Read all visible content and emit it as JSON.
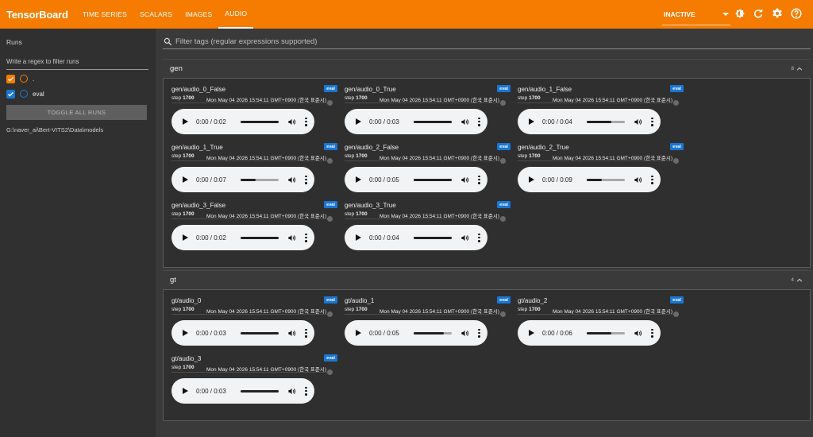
{
  "app": {
    "title": "TensorBoard"
  },
  "nav": {
    "tabs": [
      {
        "label": "TIME SERIES",
        "active": false
      },
      {
        "label": "SCALARS",
        "active": false
      },
      {
        "label": "IMAGES",
        "active": false
      },
      {
        "label": "AUDIO",
        "active": true
      }
    ],
    "status": "INACTIVE",
    "icons": [
      "brightness-icon",
      "reload-icon",
      "settings-icon",
      "help-icon"
    ]
  },
  "sidebar": {
    "title": "Runs",
    "regex_placeholder": "Write a regex to filter runs",
    "runs": [
      {
        "name": ".",
        "checked": true,
        "checkbox_color": "#f57c00",
        "swatch_color": "#f57c00"
      },
      {
        "name": "eval",
        "checked": true,
        "checkbox_color": "#1976d2",
        "swatch_color": "#1976d2"
      }
    ],
    "toggle_label": "TOGGLE ALL RUNS",
    "logdir": "G:\\naver_ai\\Bert-VITS2\\Data\\models"
  },
  "filter": {
    "placeholder": "Filter tags (regular expressions supported)"
  },
  "groups": [
    {
      "name": "gen",
      "count": "8",
      "cards": [
        {
          "tag": "gen/audio_0_False",
          "run": "eval",
          "step_label": "step",
          "step": "1700",
          "time": "Mon May 04 2026 15:54:11 GMT+0900 (한국 표준시)",
          "player_time": "0:00 / 0:02",
          "progress": 1.0
        },
        {
          "tag": "gen/audio_0_True",
          "run": "eval",
          "step_label": "step",
          "step": "1700",
          "time": "Mon May 04 2026 15:54:11 GMT+0900 (한국 표준시)",
          "player_time": "0:00 / 0:03",
          "progress": 1.0
        },
        {
          "tag": "gen/audio_1_False",
          "run": "eval",
          "step_label": "step",
          "step": "1700",
          "time": "Mon May 04 2026 15:54:11 GMT+0900 (한국 표준시)",
          "player_time": "0:00 / 0:04",
          "progress": 0.65
        },
        {
          "tag": "gen/audio_1_True",
          "run": "eval",
          "step_label": "step",
          "step": "1700",
          "time": "Mon May 04 2026 15:54:11 GMT+0900 (한국 표준시)",
          "player_time": "0:00 / 0:07",
          "progress": 0.4
        },
        {
          "tag": "gen/audio_2_False",
          "run": "eval",
          "step_label": "step",
          "step": "1700",
          "time": "Mon May 04 2026 15:54:11 GMT+0900 (한국 표준시)",
          "player_time": "0:00 / 0:05",
          "progress": 1.0
        },
        {
          "tag": "gen/audio_2_True",
          "run": "eval",
          "step_label": "step",
          "step": "1700",
          "time": "Mon May 04 2026 15:54:11 GMT+0900 (한국 표준시)",
          "player_time": "0:00 / 0:09",
          "progress": 0.4
        },
        {
          "tag": "gen/audio_3_False",
          "run": "eval",
          "step_label": "step",
          "step": "1700",
          "time": "Mon May 04 2026 15:54:11 GMT+0900 (한국 표준시)",
          "player_time": "0:00 / 0:02",
          "progress": 1.0
        },
        {
          "tag": "gen/audio_3_True",
          "run": "eval",
          "step_label": "step",
          "step": "1700",
          "time": "Mon May 04 2026 15:54:11 GMT+0900 (한국 표준시)",
          "player_time": "0:00 / 0:04",
          "progress": 1.0
        }
      ]
    },
    {
      "name": "gt",
      "count": "4",
      "cards": [
        {
          "tag": "gt/audio_0",
          "run": "eval",
          "step_label": "step",
          "step": "1700",
          "time": "Mon May 04 2026 15:54:11 GMT+0900 (한국 표준시)",
          "player_time": "0:00 / 0:03",
          "progress": 1.0
        },
        {
          "tag": "gt/audio_1",
          "run": "eval",
          "step_label": "step",
          "step": "1700",
          "time": "Mon May 04 2026 15:54:11 GMT+0900 (한국 표준시)",
          "player_time": "0:00 / 0:05",
          "progress": 0.8
        },
        {
          "tag": "gt/audio_2",
          "run": "eval",
          "step_label": "step",
          "step": "1700",
          "time": "Mon May 04 2026 15:54:11 GMT+0900 (한국 표준시)",
          "player_time": "0:00 / 0:06",
          "progress": 0.65
        },
        {
          "tag": "gt/audio_3",
          "run": "eval",
          "step_label": "step",
          "step": "1700",
          "time": "Mon May 04 2026 15:54:11 GMT+0900 (한국 표준시)",
          "player_time": "0:00 / 0:03",
          "progress": 1.0
        }
      ]
    }
  ]
}
